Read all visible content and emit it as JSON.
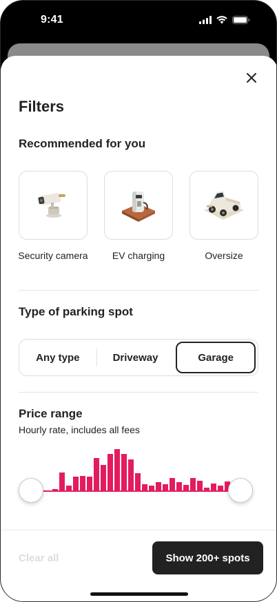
{
  "status_bar": {
    "time": "9:41"
  },
  "filters": {
    "title": "Filters",
    "recommended": {
      "heading": "Recommended for you",
      "items": [
        {
          "label": "Security camera",
          "icon": "security-camera-icon"
        },
        {
          "label": "EV charging",
          "icon": "ev-charger-icon"
        },
        {
          "label": "Oversize",
          "icon": "pickup-truck-icon"
        }
      ]
    },
    "parking_type": {
      "heading": "Type of parking spot",
      "options": [
        "Any type",
        "Driveway",
        "Garage"
      ],
      "selected": "Garage"
    },
    "price": {
      "heading": "Price range",
      "subtitle": "Hourly rate, includes all fees",
      "histogram": [
        0,
        0,
        0,
        0.05,
        0.42,
        0.12,
        0.33,
        0.35,
        0.33,
        0.75,
        0.6,
        0.85,
        0.95,
        0.85,
        0.72,
        0.4,
        0.15,
        0.12,
        0.2,
        0.16,
        0.3,
        0.2,
        0.14,
        0.3,
        0.24,
        0.08,
        0.17,
        0.12,
        0.22,
        0.18
      ],
      "accent_color": "#e31c5f"
    }
  },
  "footer": {
    "clear_label": "Clear all",
    "show_label": "Show 200+ spots"
  }
}
